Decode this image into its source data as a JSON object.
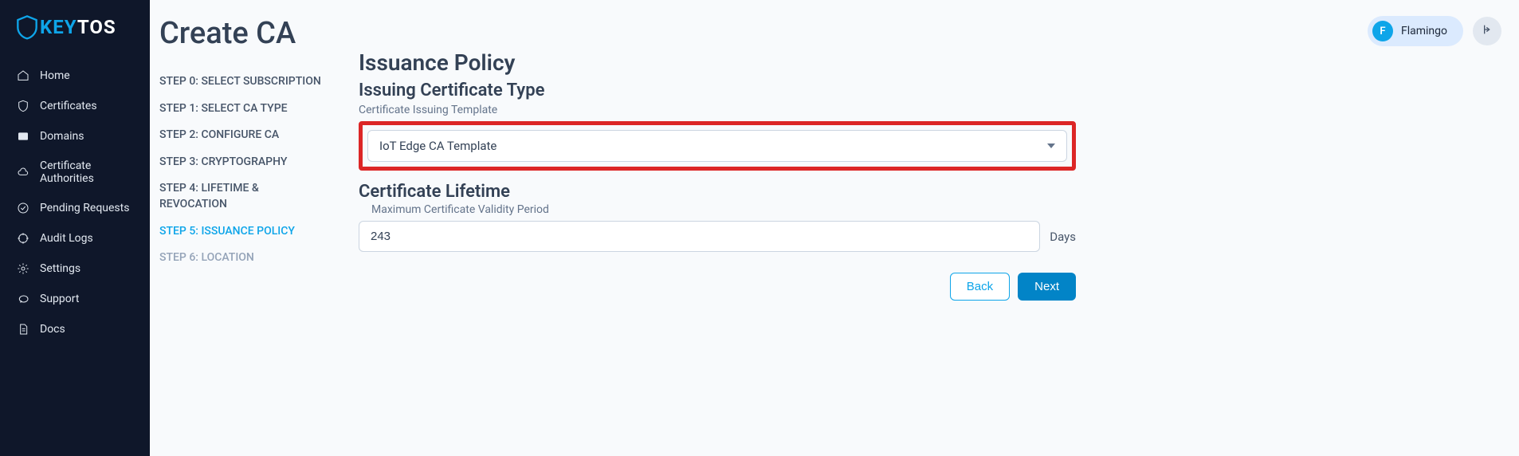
{
  "brand": {
    "key": "KEY",
    "tos": "TOS"
  },
  "sidebar": {
    "items": [
      {
        "label": "Home"
      },
      {
        "label": "Certificates"
      },
      {
        "label": "Domains"
      },
      {
        "label": "Certificate Authorities"
      },
      {
        "label": "Pending Requests"
      },
      {
        "label": "Audit Logs"
      },
      {
        "label": "Settings"
      },
      {
        "label": "Support"
      },
      {
        "label": "Docs"
      }
    ]
  },
  "user": {
    "initial": "F",
    "name": "Flamingo"
  },
  "page": {
    "title": "Create CA"
  },
  "steps": [
    {
      "label": "STEP 0: SELECT SUBSCRIPTION"
    },
    {
      "label": "STEP 1: SELECT CA TYPE"
    },
    {
      "label": "STEP 2: CONFIGURE CA"
    },
    {
      "label": "STEP 3: CRYPTOGRAPHY"
    },
    {
      "label": "STEP 4: LIFETIME & REVOCATION"
    },
    {
      "label": "STEP 5: ISSUANCE POLICY"
    },
    {
      "label": "STEP 6: LOCATION"
    }
  ],
  "form": {
    "section_title": "Issuance Policy",
    "cert_type_title": "Issuing Certificate Type",
    "template_label": "Certificate Issuing Template",
    "template_value": "IoT Edge CA Template",
    "lifetime_title": "Certificate Lifetime",
    "lifetime_label": "Maximum Certificate Validity Period",
    "lifetime_value": "243",
    "lifetime_unit": "Days",
    "back_label": "Back",
    "next_label": "Next"
  }
}
